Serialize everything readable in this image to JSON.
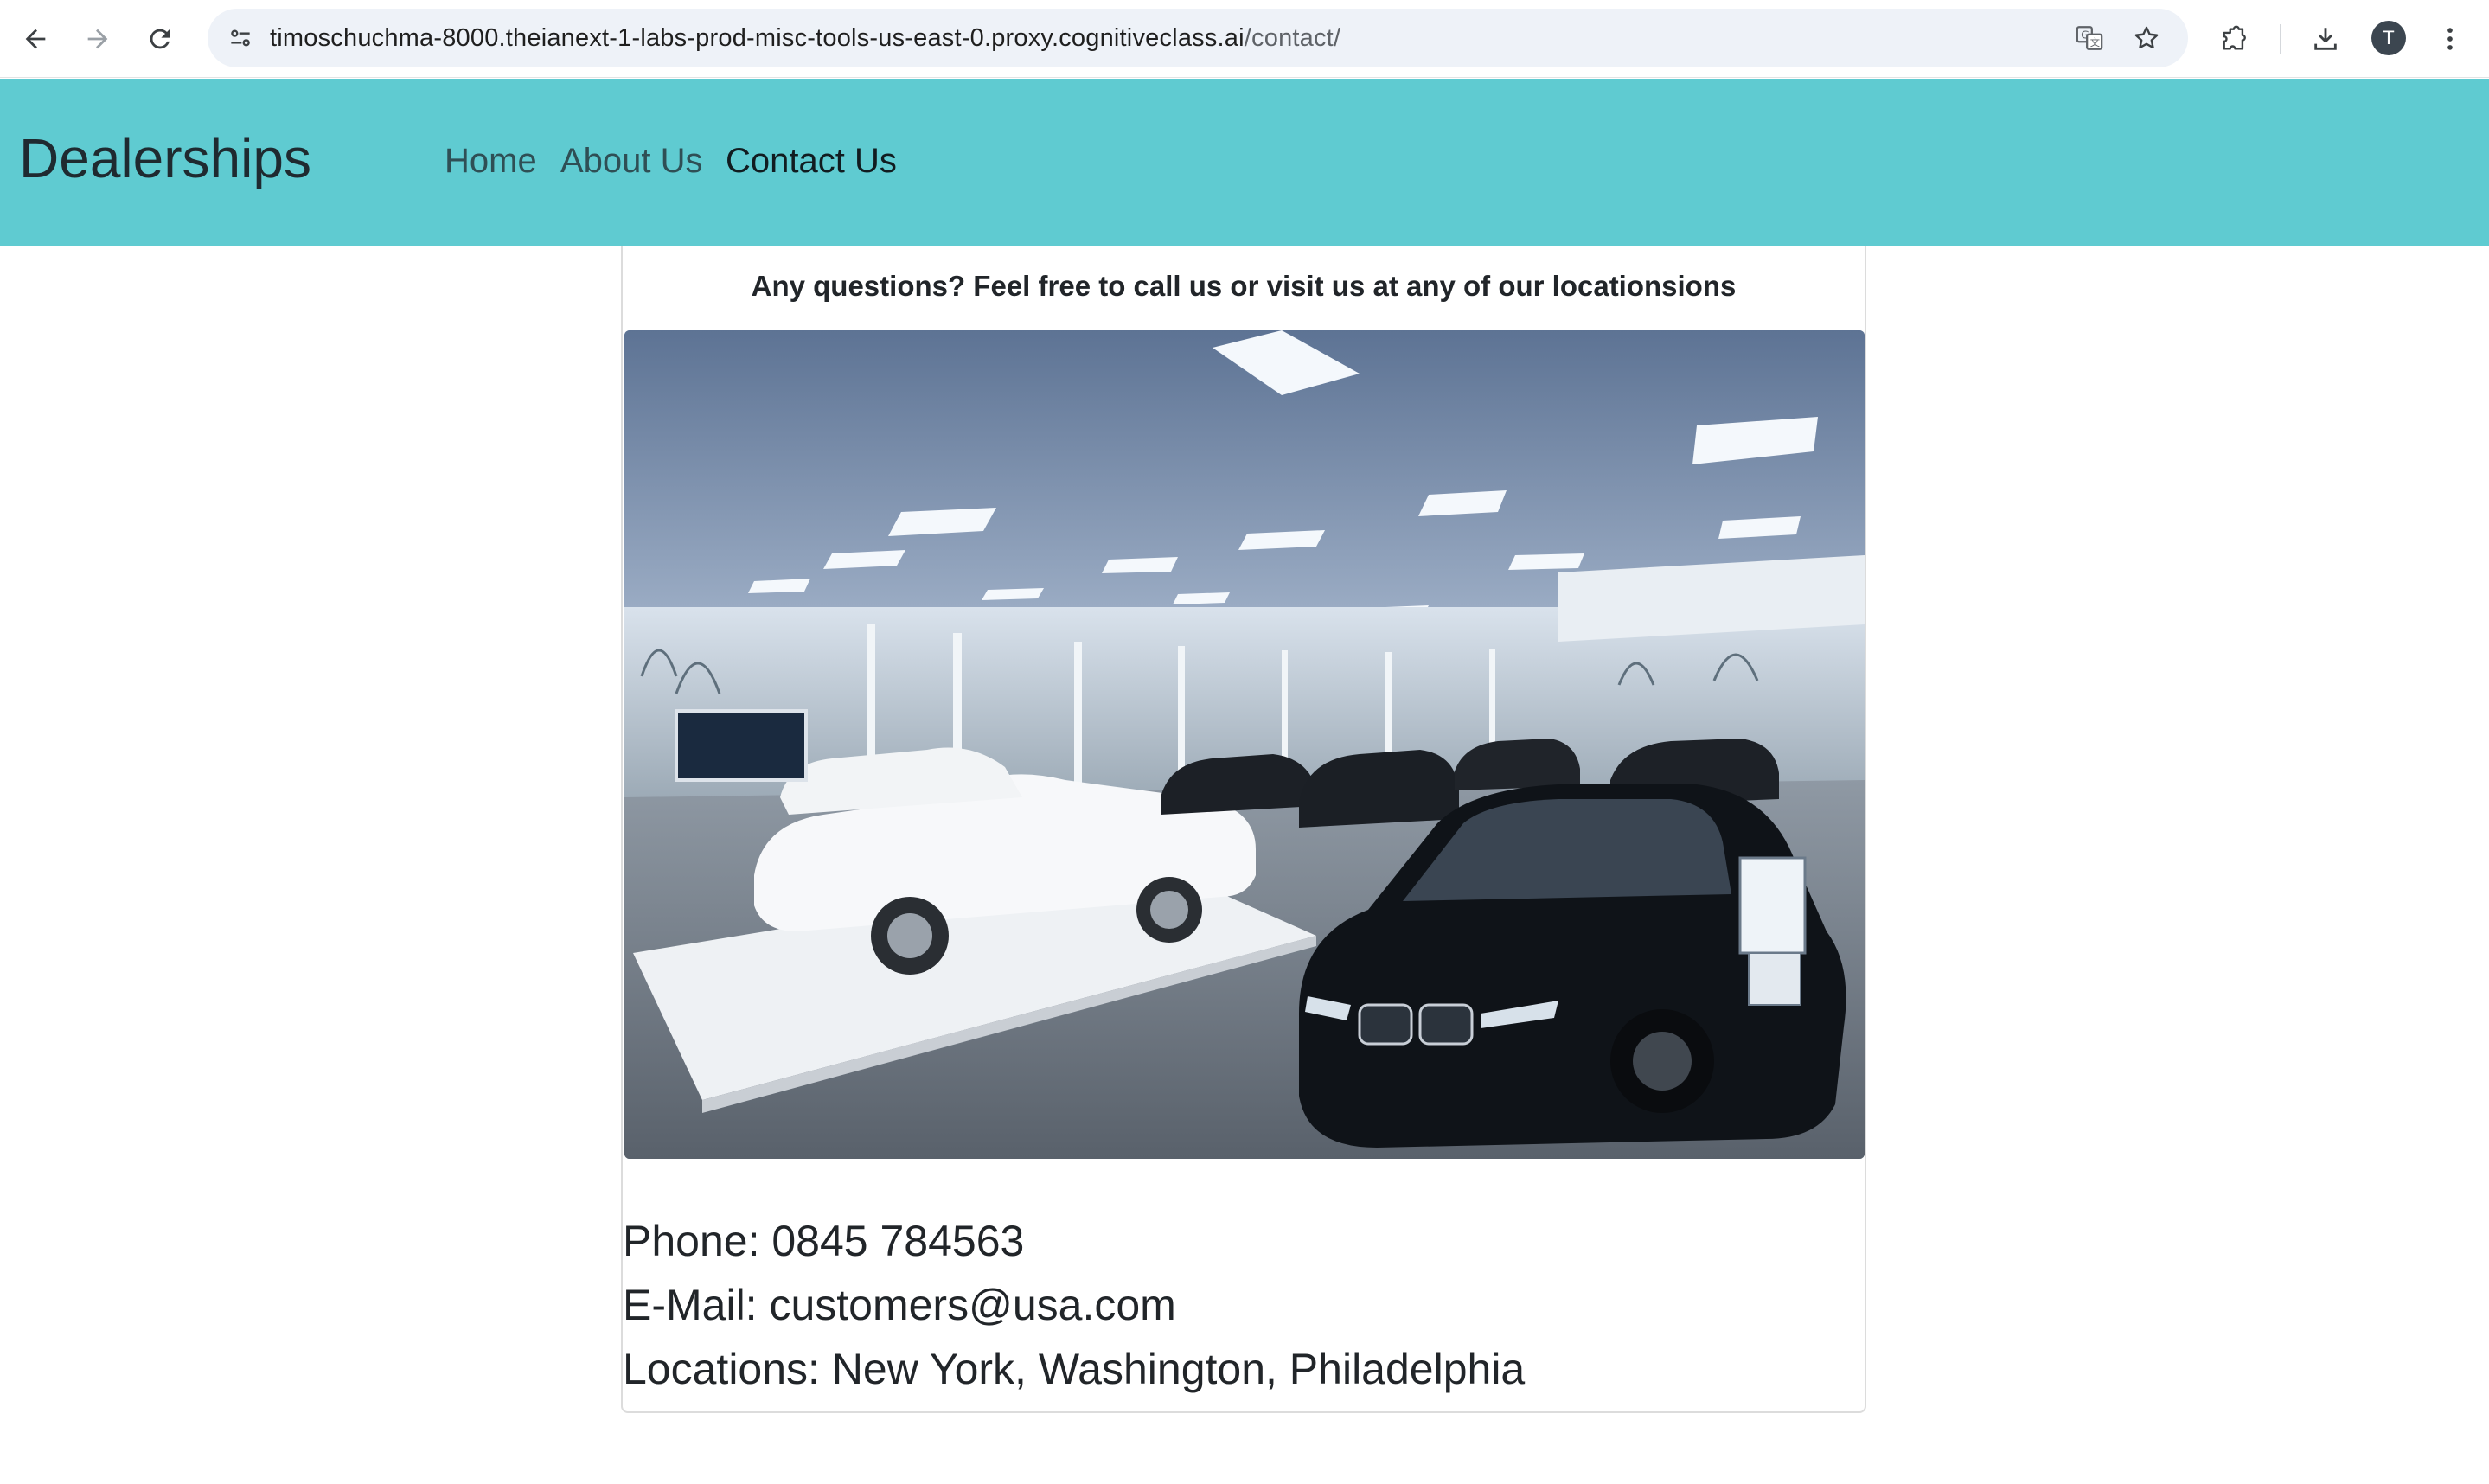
{
  "browser": {
    "url_host": "timoschuchma-8000.theianext-1-labs-prod-misc-tools-us-east-0.proxy.cognitiveclass.ai",
    "url_path": "/contact/",
    "profile_initial": "T",
    "icons": [
      "back-arrow-icon",
      "forward-arrow-icon",
      "reload-icon",
      "site-info-icon",
      "translate-icon",
      "star-icon",
      "extensions-icon",
      "download-icon",
      "kebab-menu-icon"
    ]
  },
  "navbar": {
    "brand": "Dealerships",
    "background_color": "#5fcbd1",
    "links": [
      {
        "label": "Home"
      },
      {
        "label": "About Us"
      },
      {
        "label": "Contact Us",
        "active": true
      }
    ]
  },
  "contact": {
    "heading": "Any questions? Feel free to call us or visit us at any of our locationsions",
    "image_alt": "Car dealership showroom with white convertible and black sedans",
    "phone": "Phone: 0845 784563",
    "email": "E-Mail: customers@usa.com",
    "locations": "Locations: New York, Washington, Philadelphia"
  }
}
